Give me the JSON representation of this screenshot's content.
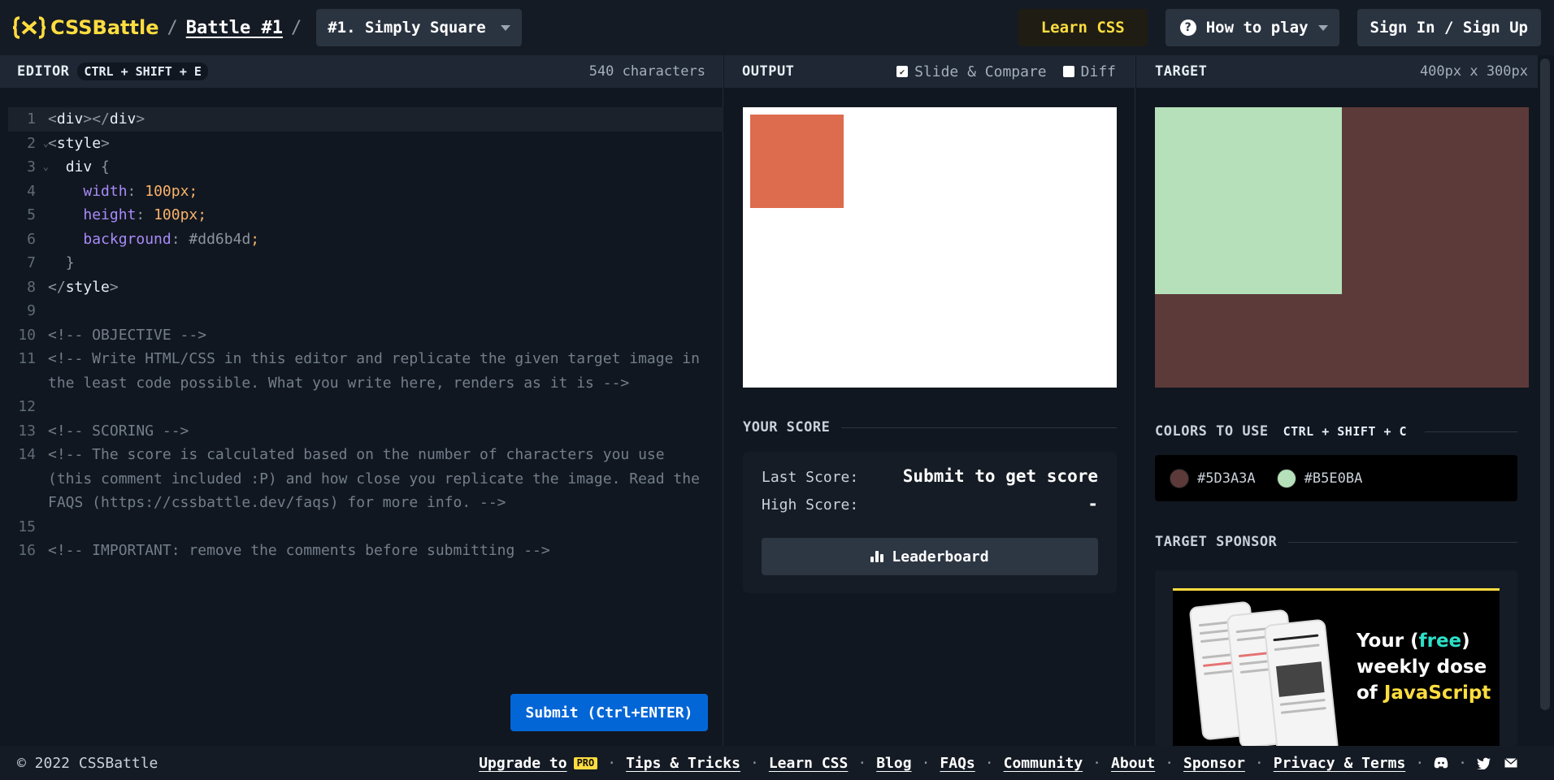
{
  "header": {
    "logo_text": "CSSBattle",
    "battle_link": "Battle #1",
    "target_select": "#1. Simply Square",
    "learn_css": "Learn CSS",
    "how_to_play": "How to play",
    "sign_in": "Sign In / Sign Up"
  },
  "editor": {
    "title": "EDITOR",
    "shortcut": "CTRL + SHIFT + E",
    "char_count": "540 characters",
    "submit_label": "Submit (Ctrl+ENTER)",
    "line_numbers": [
      "1",
      "2",
      "3",
      "4",
      "5",
      "6",
      "7",
      "8",
      "9",
      "10",
      "11",
      "12",
      "13",
      "14",
      "15",
      "16"
    ],
    "code": {
      "l4_prop": "width",
      "l4_num": "100",
      "l5_prop": "height",
      "l5_num": "100",
      "l6_prop": "background",
      "l6_val": "#dd6b4d",
      "l10": "<!-- OBJECTIVE -->",
      "l11": "<!-- Write HTML/CSS in this editor and replicate the given target image in the least code possible. What you write here, renders as it is -->",
      "l13": "<!-- SCORING -->",
      "l14": "<!-- The score is calculated based on the number of characters you use (this comment included :P) and how close you replicate the image. Read the FAQS (https://cssbattle.dev/faqs) for more info. -->",
      "l16": "<!-- IMPORTANT: remove the comments before submitting -->"
    }
  },
  "output": {
    "title": "OUTPUT",
    "slide_compare": "Slide & Compare",
    "diff": "Diff",
    "render_color": "#dd6b4d"
  },
  "score": {
    "title": "YOUR SCORE",
    "last_label": "Last Score:",
    "last_value": "Submit to get score",
    "high_label": "High Score:",
    "high_value": "-",
    "leaderboard": "Leaderboard"
  },
  "target": {
    "title": "TARGET",
    "size": "400px x 300px",
    "colors_title": "COLORS TO USE",
    "colors_shortcut": "CTRL + SHIFT + C",
    "colors": [
      {
        "label": "#5D3A3A",
        "hex": "#5D3A3A"
      },
      {
        "label": "#B5E0BA",
        "hex": "#B5E0BA"
      }
    ],
    "sponsor_title": "TARGET SPONSOR",
    "ad": {
      "line1_pre": "Your (",
      "line1_free": "free",
      "line1_post": ")",
      "line2": "weekly dose",
      "line3_pre": "of ",
      "line3_js": "JavaScript"
    }
  },
  "footer": {
    "copyright": "© 2022 CSSBattle",
    "upgrade": "Upgrade to",
    "pro_badge": "PRO",
    "links": [
      "Tips & Tricks",
      "Learn CSS",
      "Blog",
      "FAQs",
      "Community",
      "About",
      "Sponsor",
      "Privacy & Terms"
    ]
  },
  "colors": {
    "accent_yellow": "#ffdd40",
    "submit_blue": "#0366d6"
  }
}
